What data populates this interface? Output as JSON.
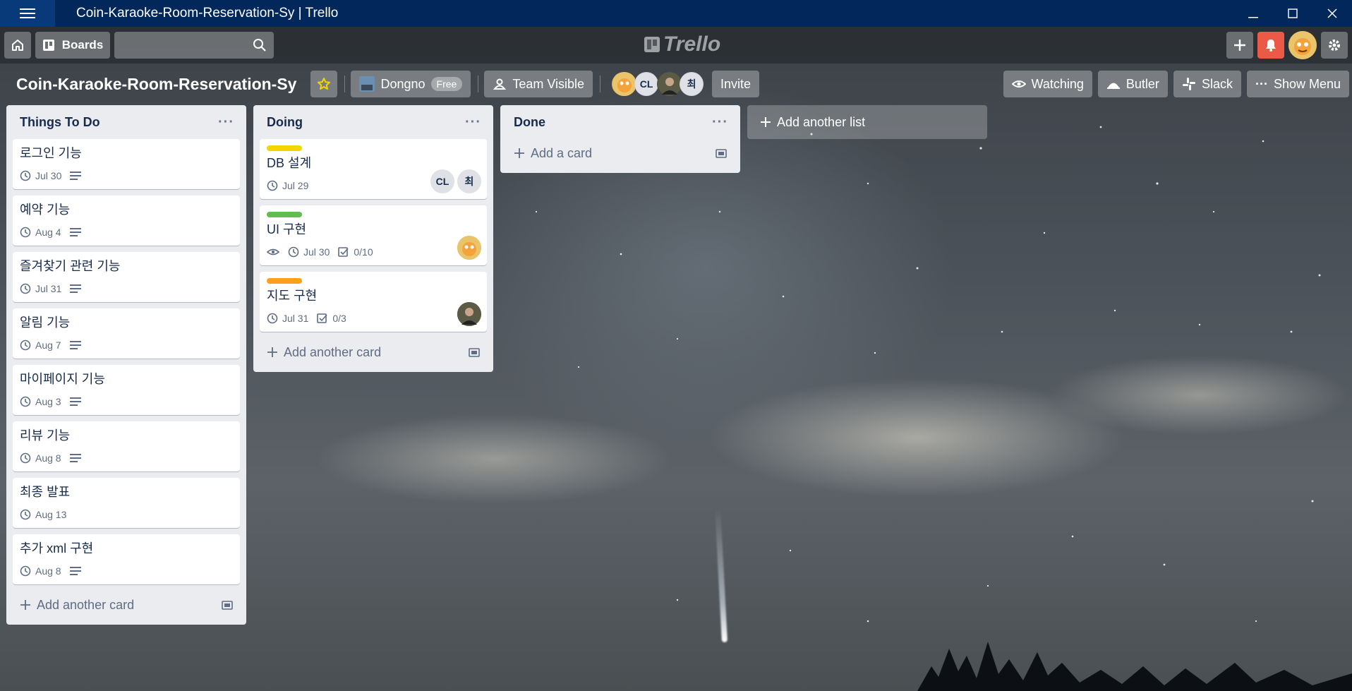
{
  "window": {
    "title": "Coin-Karaoke-Room-Reservation-Sy | Trello"
  },
  "header": {
    "boards_label": "Boards",
    "logo_text": "Trello"
  },
  "board": {
    "title": "Coin-Karaoke-Room-Reservation-Sy",
    "team": "Dongno",
    "team_plan": "Free",
    "visibility": "Team Visible",
    "members": [
      "CL",
      "최"
    ],
    "invite_label": "Invite",
    "watching_label": "Watching",
    "butler_label": "Butler",
    "slack_label": "Slack",
    "show_menu_label": "Show Menu"
  },
  "lists": {
    "todo": {
      "title": "Things To Do",
      "add_card": "Add another card",
      "cards": [
        {
          "title": "로그인 기능",
          "due": "Jul 30"
        },
        {
          "title": "예약 기능",
          "due": "Aug 4"
        },
        {
          "title": "즐겨찾기 관련 기능",
          "due": "Jul 31"
        },
        {
          "title": "알림 기능",
          "due": "Aug 7"
        },
        {
          "title": "마이페이지 기능",
          "due": "Aug 3"
        },
        {
          "title": "리뷰 기능",
          "due": "Aug 8"
        },
        {
          "title": "최종 발표",
          "due": "Aug 13"
        },
        {
          "title": "추가 xml 구현",
          "due": "Aug 8"
        }
      ]
    },
    "doing": {
      "title": "Doing",
      "add_card": "Add another card",
      "cards": [
        {
          "title": "DB 설계",
          "due": "Jul 29",
          "label_color": "#f2d600",
          "members": [
            "CL",
            "최"
          ]
        },
        {
          "title": "UI 구현",
          "due": "Jul 30",
          "checklist": "0/10",
          "label_color": "#61bd4f"
        },
        {
          "title": "지도 구현",
          "due": "Jul 31",
          "checklist": "0/3",
          "label_color": "#ff9f1a"
        }
      ]
    },
    "done": {
      "title": "Done",
      "add_card": "Add a card"
    }
  },
  "add_list_label": "Add another list",
  "colors": {
    "titlebar": "#02275a",
    "notification": "#eb5a46",
    "list_bg": "#ebecf0"
  }
}
